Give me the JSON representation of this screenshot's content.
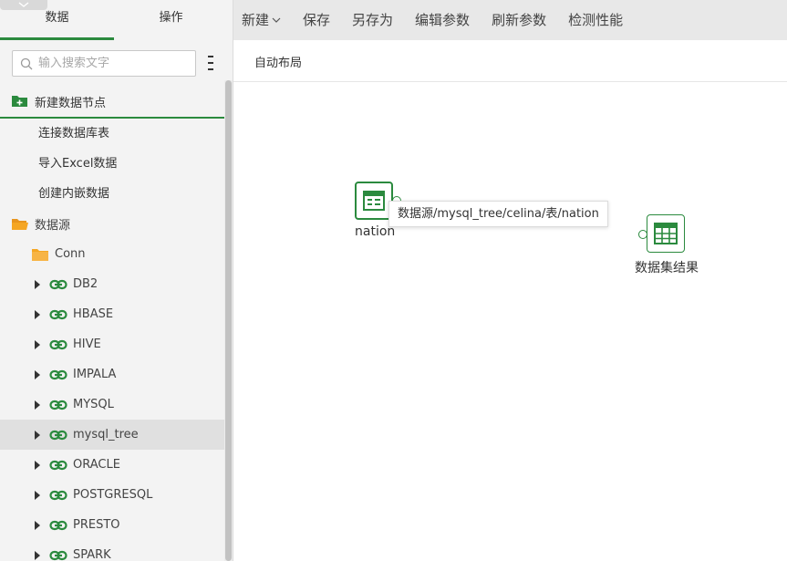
{
  "left_panel": {
    "tabs": [
      {
        "label": "数据"
      },
      {
        "label": "操作"
      }
    ],
    "search": {
      "placeholder": "输入搜索文字",
      "value": ""
    },
    "new_node_header": "新建数据节点",
    "new_node_items": [
      {
        "label": "连接数据库表"
      },
      {
        "label": "导入Excel数据"
      },
      {
        "label": "创建内嵌数据"
      }
    ],
    "datasource_root": "数据源",
    "folder": "Conn",
    "connections": [
      {
        "label": "DB2"
      },
      {
        "label": "HBASE"
      },
      {
        "label": "HIVE"
      },
      {
        "label": "IMPALA"
      },
      {
        "label": "MYSQL"
      },
      {
        "label": "mysql_tree"
      },
      {
        "label": "ORACLE"
      },
      {
        "label": "POSTGRESQL"
      },
      {
        "label": "PRESTO"
      },
      {
        "label": "SPARK"
      }
    ],
    "selected_connection": "mysql_tree"
  },
  "toolbar": {
    "new_label": "新建",
    "save_label": "保存",
    "save_as_label": "另存为",
    "edit_params_label": "编辑参数",
    "refresh_params_label": "刷新参数",
    "check_perf_label": "检测性能"
  },
  "secondbar": {
    "auto_layout_label": "自动布局"
  },
  "canvas": {
    "source_node_label": "nation",
    "result_node_label": "数据集结果",
    "tooltip": "数据源/mysql_tree/celina/表/nation"
  },
  "colors": {
    "accent": "#2b8a3e",
    "folder": "#f5a623"
  }
}
